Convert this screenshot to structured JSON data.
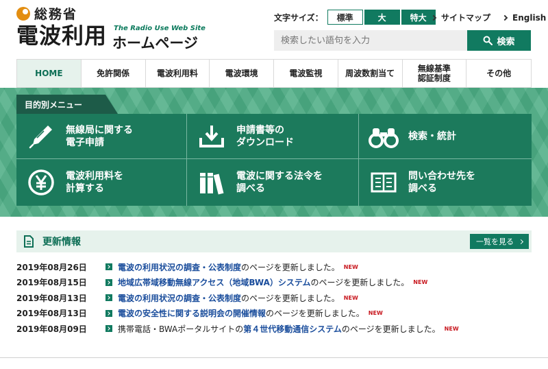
{
  "header": {
    "ministry": "総務省",
    "site_title": "電波利用",
    "site_title_en": "The Radio Use Web Site",
    "site_title_hp": "ホームページ",
    "font_size_label": "文字サイズ：",
    "font_size_options": [
      "標準",
      "大",
      "特大"
    ],
    "links": [
      "サイトマップ",
      "English"
    ],
    "search_placeholder": "検索したい語句を入力",
    "search_button": "検索"
  },
  "nav": {
    "items": [
      "HOME",
      "免許関係",
      "電波利用料",
      "電波環境",
      "電波監視",
      "周波数割当て",
      "無線基準\n認証制度",
      "その他"
    ]
  },
  "menu": {
    "tab_label": "目的別メニュー",
    "items": [
      {
        "label": "無線局に関する\n電子申請",
        "icon": "pen-icon"
      },
      {
        "label": "申請書等の\nダウンロード",
        "icon": "download-icon"
      },
      {
        "label": "検索・統計",
        "icon": "binoculars-icon"
      },
      {
        "label": "電波利用料を\n計算する",
        "icon": "yen-icon"
      },
      {
        "label": "電波に関する法令を\n調べる",
        "icon": "books-icon"
      },
      {
        "label": "問い合わせ先を\n調べる",
        "icon": "book-open-icon"
      }
    ]
  },
  "news": {
    "title": "更新情報",
    "more_button": "一覧を見る",
    "items": [
      {
        "date": "2019年08月26日",
        "pre": "",
        "link": "電波の利用状況の調査・公表制度",
        "post": "のページを更新しました。",
        "badge": "NEW"
      },
      {
        "date": "2019年08月15日",
        "pre": "",
        "link": "地域広帯域移動無線アクセス（地域BWA）システム",
        "post": "のページを更新しました。",
        "badge": "NEW"
      },
      {
        "date": "2019年08月13日",
        "pre": "",
        "link": "電波の利用状況の調査・公表制度",
        "post": "のページを更新しました。",
        "badge": "NEW"
      },
      {
        "date": "2019年08月13日",
        "pre": "",
        "link": "電波の安全性に関する説明会の開催情報",
        "post": "のページを更新しました。",
        "badge": "NEW"
      },
      {
        "date": "2019年08月09日",
        "pre": "携帯電話・BWAポータルサイトの",
        "link": "第４世代移動通信システム",
        "post": "のページを更新しました。",
        "badge": "NEW"
      }
    ]
  },
  "colors": {
    "primary": "#117a60",
    "dark": "#1d5b48",
    "banner": "#4fae86",
    "link": "#1a4d9c",
    "new": "#c8171e"
  }
}
